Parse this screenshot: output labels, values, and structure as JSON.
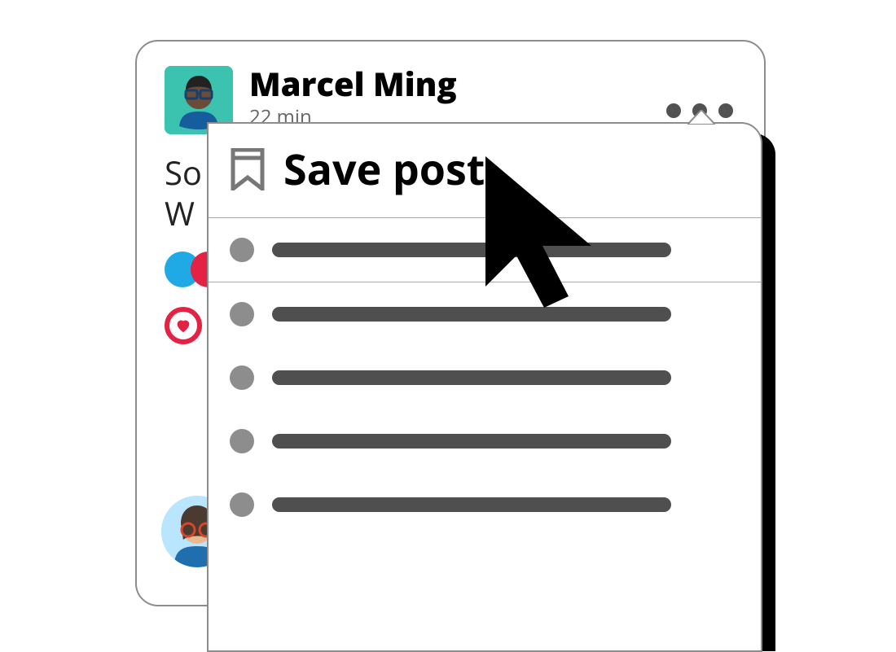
{
  "post": {
    "author_name": "Marcel Ming",
    "timestamp": "22 min",
    "body_line1": "So",
    "body_line2": "W"
  },
  "menu": {
    "save_label": "Save post"
  }
}
